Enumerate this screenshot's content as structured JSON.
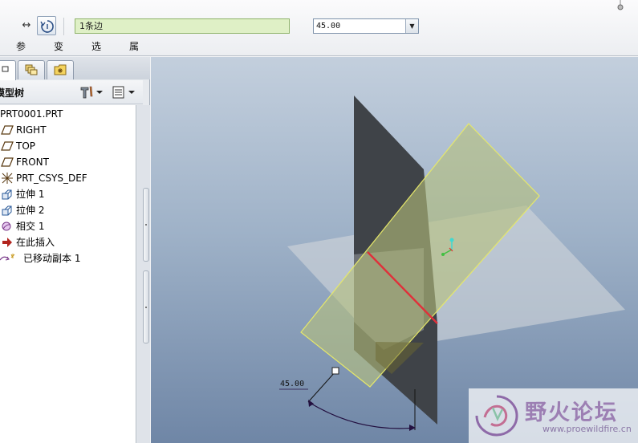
{
  "dashboard": {
    "flip_icon": "double-arrow-icon",
    "rotate_icon": "rotate-icon",
    "reference_field": "1条边",
    "angle_value": "45.00",
    "tabs": [
      "参照",
      "变换",
      "选项",
      "属性"
    ]
  },
  "navigator": {
    "tabs": [
      "model-tree-tab",
      "layers-tab",
      "folder-browser-tab"
    ],
    "title": "模型树",
    "tree": {
      "root": "PRT0001.PRT",
      "items": [
        {
          "label": "RIGHT",
          "icon": "datum-plane-icon"
        },
        {
          "label": "TOP",
          "icon": "datum-plane-icon"
        },
        {
          "label": "FRONT",
          "icon": "datum-plane-icon"
        },
        {
          "label": "PRT_CSYS_DEF",
          "icon": "coordinate-system-icon"
        },
        {
          "label": "拉伸 1",
          "icon": "extrude-icon"
        },
        {
          "label": "拉伸 2",
          "icon": "extrude-icon"
        },
        {
          "label": "相交 1",
          "icon": "intersect-icon"
        },
        {
          "label": "在此插入",
          "icon": "insert-here-arrow-icon"
        },
        {
          "label": "已移动副本 1",
          "icon": "moved-copy-icon"
        }
      ]
    }
  },
  "viewport": {
    "dimension_label": "45.00",
    "watermark": {
      "brand": "野火论坛",
      "url": "www.proewildfire.cn"
    }
  },
  "colors": {
    "viewport_top": "#c3cfdd",
    "viewport_bottom": "#6f86a6",
    "dark_plane": "#3f4348",
    "rotated_plane": "#b6bf7c",
    "selected_edge": "#e0303a",
    "reference_field_bg": "#dff0c6"
  }
}
